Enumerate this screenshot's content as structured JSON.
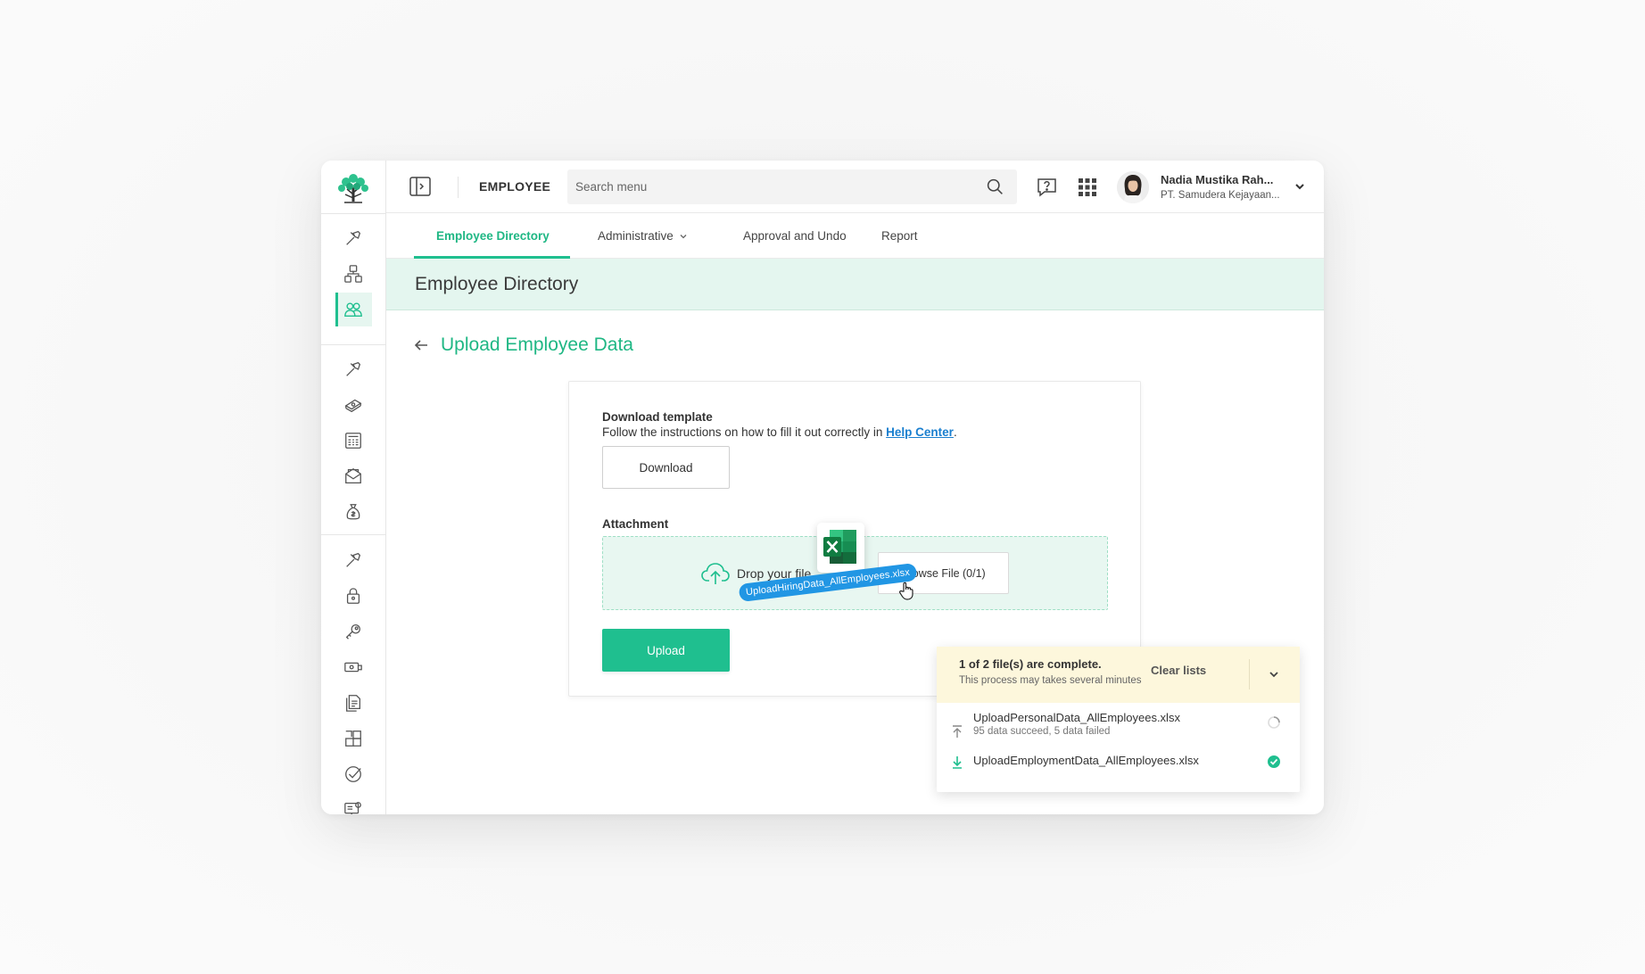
{
  "header": {
    "module_title": "EMPLOYEE",
    "search_placeholder": "Search menu",
    "user_name": "Nadia Mustika Rah...",
    "user_company": "PT. Samudera Kejayaan..."
  },
  "tabs": [
    {
      "label": "Employee Directory",
      "active": true
    },
    {
      "label": "Administrative",
      "has_dropdown": true
    },
    {
      "label": "Approval and Undo"
    },
    {
      "label": "Report"
    }
  ],
  "page": {
    "band_title": "Employee Directory",
    "sub_title": "Upload Employee Data"
  },
  "card": {
    "download_heading": "Download template",
    "download_desc": "Follow the instructions on how to fill it out correctly in",
    "help_link": "Help Center",
    "download_desc_end": ".",
    "download_button": "Download",
    "attachment_heading": "Attachment",
    "drop_text": "Drop your file",
    "browse_button": "Browse File (0/1)",
    "upload_button": "Upload",
    "dragging_file": "UploadHiringData_AllEmployees.xlsx"
  },
  "progress": {
    "title": "1 of 2 file(s) are complete.",
    "subtitle": "This process may takes several minutes",
    "clear_label": "Clear lists",
    "files": [
      {
        "name": "UploadPersonalData_AllEmployees.xlsx",
        "meta": "95 data succeed, 5 data failed",
        "status": "loading",
        "icon": "upload-icon"
      },
      {
        "name": "UploadEmploymentData_AllEmployees.xlsx",
        "meta": "",
        "status": "complete",
        "icon": "download-icon"
      }
    ]
  },
  "sidebar_icons": [
    "wrench-icon",
    "org-chart-icon",
    "employees-icon",
    "wrench-icon",
    "money-stack-icon",
    "calculator-icon",
    "mail-icon",
    "money-bag-icon",
    "wrench-icon",
    "lock-icon",
    "key-icon",
    "cash-icon",
    "documents-icon",
    "puzzle-icon",
    "badge-check-icon",
    "monitor-settings-icon"
  ],
  "colors": {
    "accent": "#1fbf8f",
    "accent_text": "#1fb784",
    "band_bg": "#e4f6ef",
    "link": "#1a7fcf",
    "notice_bg": "#fdf7dc",
    "drag_chip": "#2196e4"
  }
}
